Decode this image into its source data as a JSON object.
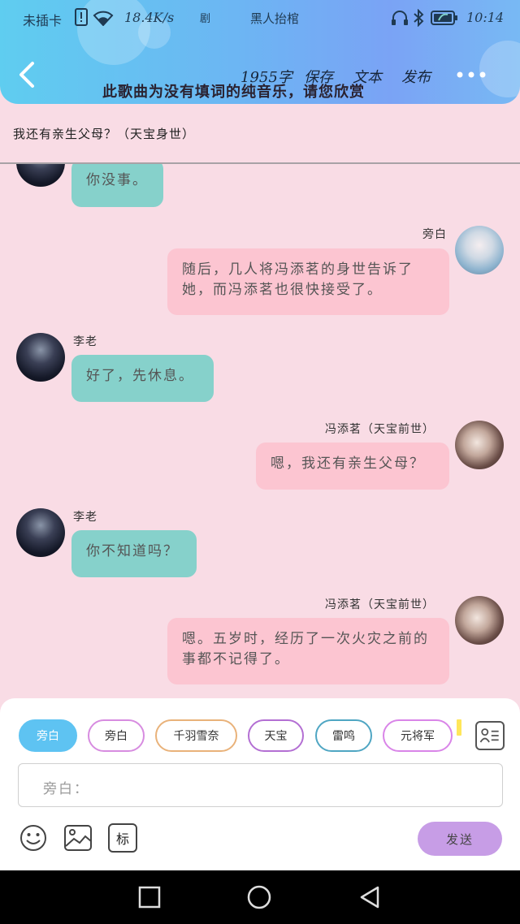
{
  "status_bar": {
    "carrier": "未插卡",
    "speed": "18.4K/s",
    "marker": "剧",
    "app_name": "黑人抬棺",
    "time": "10:14"
  },
  "toolbar": {
    "word_count": "1955字",
    "save_label": "保存",
    "text_label": "文本",
    "publish_label": "发布",
    "marquee": "此歌曲为没有填词的纯音乐，请您欣赏"
  },
  "chat": {
    "title": "我还有亲生父母？（天宝身世）"
  },
  "messages": [
    {
      "side": "left",
      "speaker": "",
      "text": "你没事。",
      "avatar": "dark-warrior-avatar"
    },
    {
      "side": "right",
      "speaker": "旁白",
      "text": "随后，几人将冯添茗的身世告诉了她，而冯添茗也很快接受了。",
      "avatar": "white-hair-girl-avatar"
    },
    {
      "side": "left",
      "speaker": "李老",
      "text": "好了，先休息。",
      "avatar": "dark-warrior-avatar"
    },
    {
      "side": "right",
      "speaker": "冯添茗（天宝前世）",
      "text": "嗯，我还有亲生父母？",
      "avatar": "feng-avatar"
    },
    {
      "side": "left",
      "speaker": "李老",
      "text": "你不知道吗？",
      "avatar": "dark-warrior-avatar"
    },
    {
      "side": "right",
      "speaker": "冯添茗（天宝前世）",
      "text": "嗯。五岁时，经历了一次火灾之前的事都不记得了。",
      "avatar": "feng-avatar"
    }
  ],
  "role_chips": [
    {
      "label": "旁白",
      "active": true,
      "color": "#5ec3f2"
    },
    {
      "label": "旁白",
      "active": false,
      "color": "#d78ce0"
    },
    {
      "label": "千羽雪奈",
      "active": false,
      "color": "#e9b27a"
    },
    {
      "label": "天宝",
      "active": false,
      "color": "#b36fd3"
    },
    {
      "label": "雷鸣",
      "active": false,
      "color": "#4fa6c3"
    },
    {
      "label": "元将军",
      "active": false,
      "color": "#d985e8"
    }
  ],
  "composer": {
    "input_value": "旁白：",
    "mark_label": "标",
    "send_label": "发送"
  },
  "colors": {
    "background": "#f9dce5",
    "teal_bubble": "#86d1cb",
    "pink_bubble": "#fcc5d1",
    "send_button": "#c79de6"
  }
}
